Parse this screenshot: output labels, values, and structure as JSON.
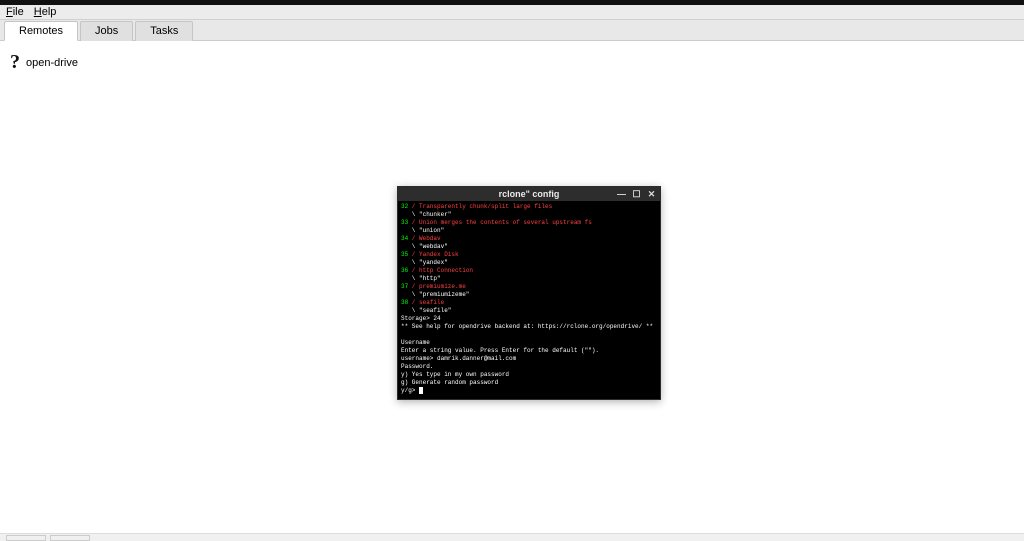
{
  "menubar": {
    "file": "File",
    "help": "Help"
  },
  "tabs": {
    "remotes": "Remotes",
    "jobs": "Jobs",
    "tasks": "Tasks"
  },
  "remote_entry": {
    "label": "open-drive"
  },
  "terminal": {
    "title": "rclone\" config",
    "lines": [
      {
        "c": "green",
        "t": "32"
      },
      {
        "c": "red",
        "t": " / Transparently chunk/split large files"
      },
      {
        "c": "white",
        "t": "   \\ \"chunker\""
      },
      {
        "c": "green",
        "t": "33"
      },
      {
        "c": "red",
        "t": " / Union merges the contents of several upstream fs"
      },
      {
        "c": "white",
        "t": "   \\ \"union\""
      },
      {
        "c": "green",
        "t": "34"
      },
      {
        "c": "red",
        "t": " / Webdav"
      },
      {
        "c": "white",
        "t": "   \\ \"webdav\""
      },
      {
        "c": "green",
        "t": "35"
      },
      {
        "c": "red",
        "t": " / Yandex Disk"
      },
      {
        "c": "white",
        "t": "   \\ \"yandex\""
      },
      {
        "c": "green",
        "t": "36"
      },
      {
        "c": "red",
        "t": " / http Connection"
      },
      {
        "c": "white",
        "t": "   \\ \"http\""
      },
      {
        "c": "green",
        "t": "37"
      },
      {
        "c": "red",
        "t": " / premiumize.me"
      },
      {
        "c": "white",
        "t": "   \\ \"premiumizeme\""
      },
      {
        "c": "green",
        "t": "38"
      },
      {
        "c": "red",
        "t": " / seafile"
      },
      {
        "c": "white",
        "t": "   \\ \"seafile\""
      },
      {
        "c": "white",
        "t": "Storage> 24"
      },
      {
        "c": "white",
        "t": "** See help for opendrive backend at: https://rclone.org/opendrive/ **"
      },
      {
        "c": "white",
        "t": ""
      },
      {
        "c": "white",
        "t": "Username"
      },
      {
        "c": "white",
        "t": "Enter a string value. Press Enter for the default (\"\")."
      },
      {
        "c": "white",
        "t": "username> damrik.danner@mail.com"
      },
      {
        "c": "white",
        "t": "Password."
      },
      {
        "c": "white",
        "t": "y) Yes type in my own password"
      },
      {
        "c": "white",
        "t": "g) Generate random password"
      },
      {
        "c": "white",
        "t": "y/g> "
      }
    ]
  }
}
